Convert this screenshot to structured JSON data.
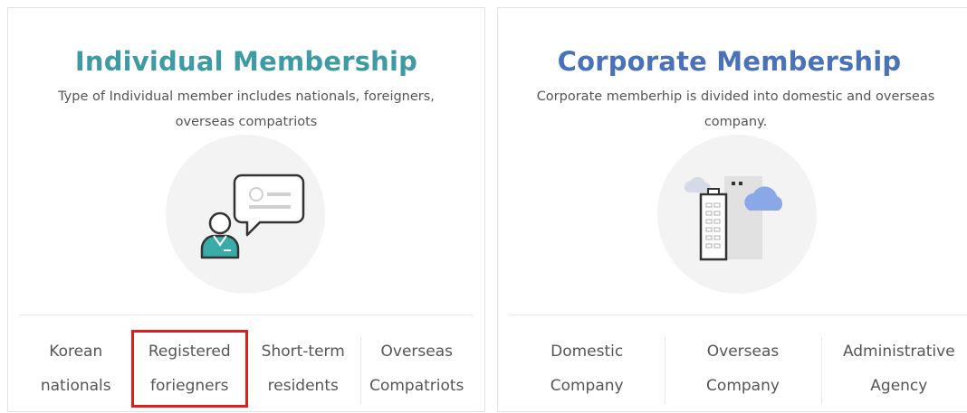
{
  "individual": {
    "title": "Individual Membership",
    "desc_line1": "Type of Individual member includes nationals, foreigners,",
    "desc_line2": "overseas compatriots",
    "types": [
      {
        "line1": "Korean",
        "line2": "nationals"
      },
      {
        "line1": "Registered",
        "line2": "foriegners"
      },
      {
        "line1": "Short-term",
        "line2": "residents"
      },
      {
        "line1": "Overseas",
        "line2": "Compatriots"
      }
    ],
    "selected_index": 1
  },
  "corporate": {
    "title": "Corporate Membership",
    "desc_line1": "Corporate memberhip is divided into domestic and overseas",
    "desc_line2": "company.",
    "types": [
      {
        "line1": "Domestic",
        "line2": "Company"
      },
      {
        "line1": "Overseas",
        "line2": "Company"
      },
      {
        "line1": "Administrative",
        "line2": "Agency"
      }
    ]
  },
  "icons": {
    "individual": "person-with-speech-bubble-icon",
    "corporate": "buildings-with-clouds-icon"
  },
  "colors": {
    "individual_title": "#3e9aa3",
    "corporate_title": "#4a72b8",
    "selection_outline": "#e01c1c",
    "person_teal": "#3aaba6",
    "cloud_blue": "#8aa7e6"
  }
}
